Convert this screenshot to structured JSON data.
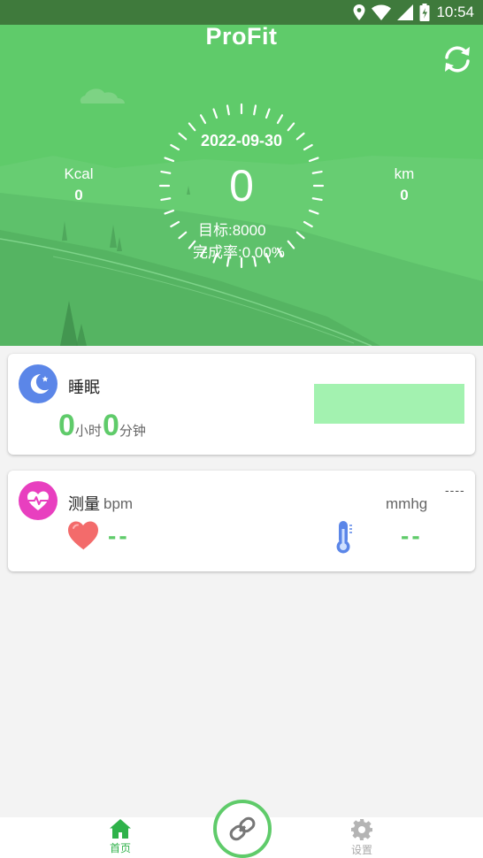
{
  "status_bar": {
    "time": "10:54"
  },
  "app": {
    "title": "ProFit"
  },
  "dashboard": {
    "date": "2022-09-30",
    "steps": "0",
    "goal": "目标:8000",
    "completion": "完成率:0.00%",
    "kcal": {
      "label": "Kcal",
      "value": "0"
    },
    "km": {
      "label": "km",
      "value": "0"
    },
    "progress_fraction": 0
  },
  "sleep": {
    "title": "睡眠",
    "hours": "0",
    "hours_unit": "小时",
    "minutes": "0",
    "minutes_unit": "分钟"
  },
  "measure": {
    "title": "测量",
    "heart_unit": "bpm",
    "pressure_unit": "mmhg",
    "corner_value": "----",
    "heart_value": "--",
    "pressure_value": "--"
  },
  "nav": {
    "home_label": "首页",
    "settings_label": "设置"
  },
  "colors": {
    "primary_green": "#5fcb6a",
    "status_bar": "#3f7a3c",
    "sleep_icon": "#5b86e8",
    "measure_icon": "#e83fbf"
  },
  "icons": [
    "location-icon",
    "wifi-icon",
    "signal-icon",
    "battery-icon",
    "refresh-icon",
    "moon-icon",
    "heartbeat-icon",
    "heart-icon",
    "thermometer-icon",
    "home-icon",
    "link-icon",
    "gear-icon"
  ]
}
